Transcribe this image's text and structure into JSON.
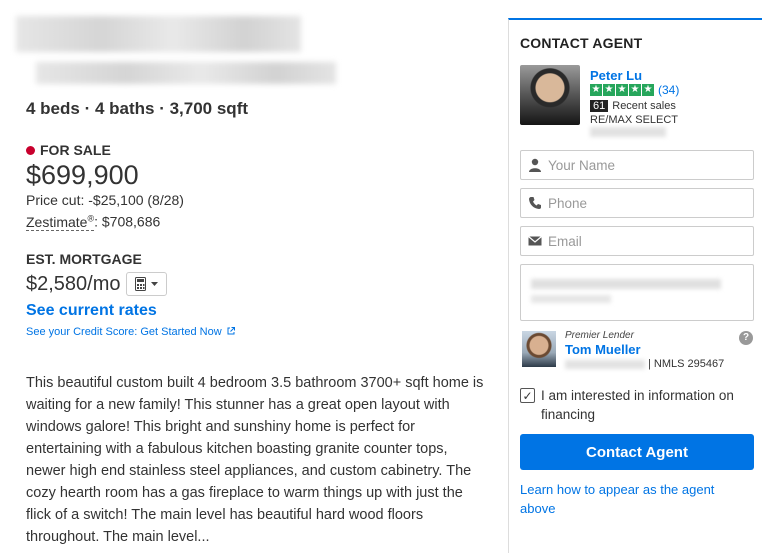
{
  "listing": {
    "specs": "4 beds · 4 baths · 3,700 sqft",
    "status": "FOR SALE",
    "price": "$699,900",
    "price_cut": "Price cut: -$25,100 (8/28)",
    "zestimate_label": "Zestimate",
    "zestimate_reg": "®",
    "zestimate_value": ": $708,686",
    "mortgage_title": "EST. MORTGAGE",
    "mortgage_value": "$2,580/mo",
    "see_rates": "See current rates",
    "credit_link": "See your Credit Score: Get Started Now",
    "description": "This beautiful custom built 4 bedroom 3.5 bathroom 3700+ sqft home is waiting for a new family! This stunner has a great open layout with windows galore! This bright and sunshiny home is perfect for entertaining with a fabulous kitchen boasting granite counter tops, newer high end stainless steel appliances, and custom cabinetry. The cozy hearth room has a gas fireplace to warm things up with just the flick of a switch! The main level has beautiful hard wood floors throughout. The main level..."
  },
  "contact": {
    "title": "CONTACT AGENT",
    "agent_name": "Peter Lu",
    "review_count": "(34)",
    "stars": [
      "★",
      "★",
      "★",
      "★",
      "★"
    ],
    "recent_count": "61",
    "recent_label": "Recent sales",
    "brokerage": "RE/MAX SELECT",
    "name_placeholder": "Your Name",
    "phone_placeholder": "Phone",
    "email_placeholder": "Email",
    "premier_label": "Premier Lender",
    "lender_name": "Tom Mueller",
    "nmls": "| NMLS 295467",
    "help": "?",
    "financing_label": "I am interested in information on financing",
    "contact_button": "Contact Agent",
    "learn_link": "Learn how to appear as the agent above"
  },
  "colors": {
    "accent": "#0074e4",
    "status_dot": "#c8002d",
    "star": "#26a65b"
  }
}
